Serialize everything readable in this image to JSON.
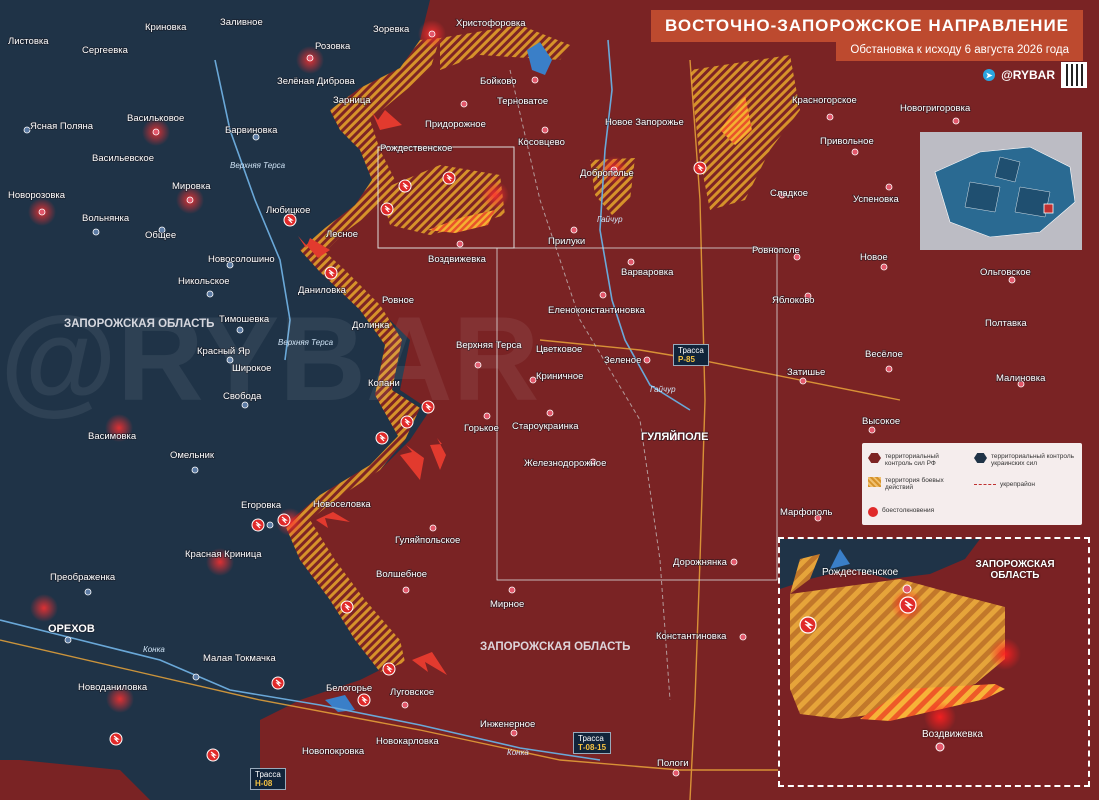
{
  "header": {
    "title": "ВОСТОЧНО-ЗАПОРОЖСКОЕ НАПРАВЛЕНИЕ",
    "subtitle": "Обстановка к исходу 6 августа 2026 года",
    "brand": "@RYBAR"
  },
  "colors": {
    "rf_control": "#7d2424",
    "ua_control": "#23384c",
    "combat_zone": "#d6922a",
    "clash": "#e03030"
  },
  "regions": {
    "left": "ЗАПОРОЖСКАЯ ОБЛАСТЬ",
    "center": "ЗАПОРОЖСКАЯ ОБЛАСТЬ",
    "inset": "ЗАПОРОЖСКАЯ ОБЛАСТЬ"
  },
  "rivers": {
    "verkhnyaya_tersa_1": "Верхняя Терса",
    "verkhnyaya_tersa_2": "Верхняя Терса",
    "gaichur_1": "Гайчур",
    "gaichur_2": "Гайчур",
    "konka_1": "Конка",
    "konka_2": "Конка"
  },
  "highways": [
    {
      "label": "Трасса",
      "code": "Р-85"
    },
    {
      "label": "Трасса",
      "code": "Т-08-15"
    },
    {
      "label": "Трасса",
      "code": "Н-08"
    }
  ],
  "places": {
    "listovka": "Листовка",
    "sergeevka": "Сергеевка",
    "krinovka": "Криновка",
    "zalivnoe": "Заливное",
    "rozovka": "Розовка",
    "zorevka": "Зоревка",
    "khristoforovka": "Христофоровка",
    "zelenaya_dibrova": "Зелёная Диброва",
    "boikovo": "Бойково",
    "ternovatoe": "Терноватое",
    "yasnaya_polyana": "Ясная Поляна",
    "vasilkovoe": "Васильковое",
    "barvinovka": "Барвиновка",
    "zarnitsa": "Зарница",
    "pridorozhnoe": "Придорожное",
    "novoe_zaporozhe": "Новое Запорожье",
    "krasnogorskoe": "Красногорское",
    "novogrigorovka": "Новогригоровка",
    "vasilevskoe": "Васильевское",
    "kosovtsevo": "Косовцево",
    "rozhdestvenskoe": "Рождественское",
    "dobropole": "Доброполье",
    "privolnoe": "Привольное",
    "novorozovka": "Новорозовка",
    "mirovka": "Мировка",
    "volnyanka": "Вольнянка",
    "lyubitskoe": "Любицкое",
    "sladkoe": "Сладкое",
    "uspenovka": "Успеновка",
    "obshchee": "Общее",
    "lesnoe": "Лесное",
    "priluki": "Прилуки",
    "vozdvizhevka": "Воздвижевка",
    "novosoloshino": "Новосолошино",
    "varvarovka": "Варваровка",
    "rovnopole": "Ровнополе",
    "novoe": "Новое",
    "olgovskoe": "Ольговское",
    "nikolskoe": "Никольское",
    "danilovka": "Даниловка",
    "yablokovo": "Яблоково",
    "rovnoe": "Ровное",
    "elenokonstantinovka": "Еленоконстантиновка",
    "timoshevka": "Тимошевка",
    "dolinka": "Долинка",
    "poltavka": "Полтавка",
    "verkhnyaya_tersa": "Верхняя Терса",
    "tsvetkovoe": "Цветковое",
    "zelenoe": "Зеленое",
    "veseloe": "Весёлое",
    "krasny_yar": "Красный Яр",
    "shirokoe": "Широкое",
    "krinichnoe": "Криничное",
    "zatishe": "Затишье",
    "malinovka": "Малиновка",
    "svoboda": "Свобода",
    "kopani": "Копани",
    "vasimovka": "Васимовка",
    "gorkoe": "Горькое",
    "staroukrainka": "Староукраинка",
    "gulyaipole": "ГУЛЯЙПОЛЕ",
    "vysokoe": "Высокое",
    "omelnik": "Омельник",
    "zheleznodorozhnoe": "Железнодорожное",
    "egorovka": "Егоровка",
    "novoselovka": "Новоселовка",
    "marfopol": "Марфополь",
    "gulyaipolskoe": "Гуляйпольское",
    "krasnaya_krinitsa": "Красная Криница",
    "dorozhnyanka": "Дорожнянка",
    "preobrazhenka": "Преображенка",
    "volshebnoe": "Волшебное",
    "orekhov": "ОРЕХОВ",
    "mirnoe": "Мирное",
    "konstantinovka": "Константиновка",
    "malaya_tokmachka": "Малая Токмачка",
    "novodanilovka": "Новоданиловка",
    "belogorye": "Белогорье",
    "lugovskoe": "Луговское",
    "inzhenernoe": "Инженерное",
    "novokarlovka": "Новокарловка",
    "novopokrovka": "Новопокровка",
    "pologi": "Пологи",
    "inset_rozhdestvenskoe": "Рождественское",
    "inset_vozdvizhevka": "Воздвижевка"
  },
  "legend": {
    "rf": "территориальный контроль сил РФ",
    "ua": "территориальный контроль украинских сил",
    "combat": "территория боевых действий",
    "border": "укрепрайон",
    "clash": "боестолкновения"
  }
}
